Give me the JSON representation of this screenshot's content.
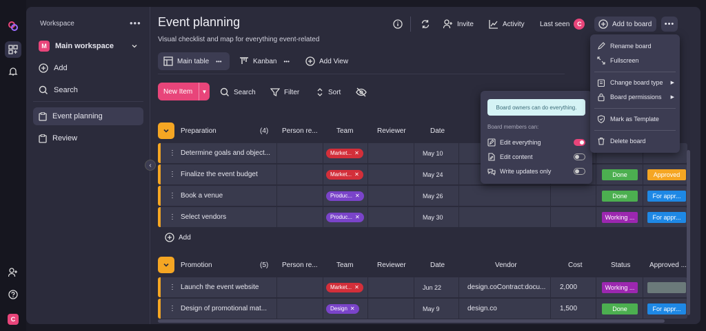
{
  "colors": {
    "accent": "#e8457a",
    "group_accent": "#f5a623",
    "done": "#4caf50",
    "working": "#9c27b0",
    "approved": "#f5a623",
    "for_approval": "#1e88e5",
    "tag_red": "#d32f3a",
    "tag_purple": "#7a44c9"
  },
  "rail": {
    "user_initial": "C"
  },
  "sidebar": {
    "workspace_label": "Workspace",
    "workspace_avatar": "M",
    "workspace_name": "Main workspace",
    "add_label": "Add",
    "search_label": "Search",
    "boards": [
      {
        "label": "Event planning"
      },
      {
        "label": "Review"
      }
    ]
  },
  "header": {
    "title": "Event planning",
    "subtitle": "Visual checklist and map for everything event-related",
    "invite_label": "Invite",
    "activity_label": "Activity",
    "last_seen_label": "Last seen",
    "last_seen_avatar": "C",
    "add_to_board_label": "Add to board"
  },
  "tabs": {
    "main_table": "Main table",
    "kanban": "Kanban",
    "add_view": "Add View"
  },
  "toolbar": {
    "new_item": "New Item",
    "search": "Search",
    "filter": "Filter",
    "sort": "Sort"
  },
  "columns": {
    "person": "Person re...",
    "team": "Team",
    "reviewer": "Reviewer",
    "date": "Date",
    "vendor": "Vendor",
    "cost": "Cost",
    "status": "Status",
    "approved": "Approved ..."
  },
  "groups": [
    {
      "name": "Preparation",
      "count": "(4)",
      "rows": [
        {
          "name": "Determine goals and object...",
          "team": "Market...",
          "team_color": "red",
          "date": "May 10",
          "vendor": "",
          "cost": "",
          "status": "",
          "approved": ""
        },
        {
          "name": "Finalize the event budget",
          "team": "Market...",
          "team_color": "red",
          "date": "May 24",
          "vendor": "",
          "cost": "",
          "status": "Done",
          "approved": "Approved"
        },
        {
          "name": "Book a venue",
          "team": "Produc...",
          "team_color": "purple",
          "date": "May 26",
          "vendor": "",
          "cost": "",
          "status": "Done",
          "approved": "For appr..."
        },
        {
          "name": "Select vendors",
          "team": "Produc...",
          "team_color": "purple",
          "date": "May 30",
          "vendor": "",
          "cost": "",
          "status": "Working ...",
          "approved": "For appr..."
        }
      ]
    },
    {
      "name": "Promotion",
      "count": "(5)",
      "rows": [
        {
          "name": "Launch the event website",
          "team": "Market...",
          "team_color": "red",
          "date": "Jun 22",
          "vendor": "design.coContract:docu...",
          "cost": "2,000",
          "status": "Working ...",
          "approved": ""
        },
        {
          "name": "Design of promotional mat...",
          "team": "Design",
          "team_color": "purple",
          "date": "May 9",
          "vendor": "design.co",
          "cost": "1,500",
          "status": "Done",
          "approved": "For appr..."
        }
      ]
    }
  ],
  "add_row_label": "Add",
  "permissions_popup": {
    "info": "Board owners can do everything.",
    "members_label": "Board members can:",
    "options": [
      {
        "label": "Edit everything",
        "on": true
      },
      {
        "label": "Edit content",
        "on": false
      },
      {
        "label": "Write updates only",
        "on": false
      }
    ]
  },
  "board_menu": {
    "rename": "Rename board",
    "fullscreen": "Fullscreen",
    "change_type": "Change board type",
    "permissions": "Board permissions",
    "mark_template": "Mark as Template",
    "delete": "Delete board"
  }
}
